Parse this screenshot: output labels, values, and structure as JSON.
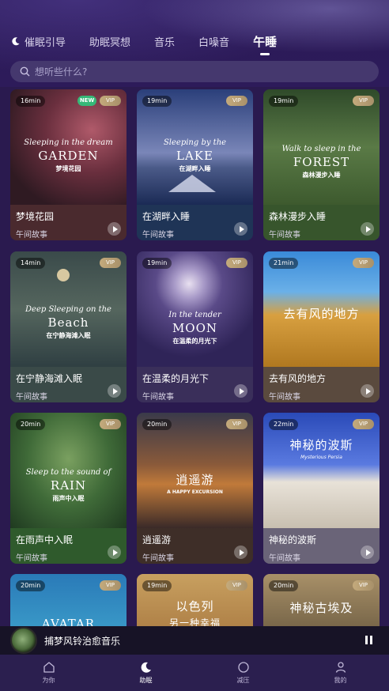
{
  "tabs": [
    {
      "label": "催眠引导"
    },
    {
      "label": "助眠冥想"
    },
    {
      "label": "音乐"
    },
    {
      "label": "白噪音"
    },
    {
      "label": "午睡"
    }
  ],
  "search": {
    "placeholder": "想听些什么?"
  },
  "cards": [
    {
      "title": "梦境花园",
      "sub": "午间故事",
      "duration": "16min",
      "vip": "VIP",
      "new": "NEW",
      "art": {
        "l1": "Sleeping in the dream",
        "l2": "GARDEN",
        "l3": "梦境花园"
      }
    },
    {
      "title": "在湖畔入睡",
      "sub": "午间故事",
      "duration": "19min",
      "vip": "VIP",
      "art": {
        "l1": "Sleeping by the",
        "l2": "LAKE",
        "l3": "在湖畔入睡"
      }
    },
    {
      "title": "森林漫步入睡",
      "sub": "午间故事",
      "duration": "19min",
      "vip": "VIP",
      "art": {
        "l1": "Walk to sleep in the",
        "l2": "FOREST",
        "l3": "森林漫步入睡"
      }
    },
    {
      "title": "在宁静海滩入眠",
      "sub": "午间故事",
      "duration": "14min",
      "vip": "VIP",
      "art": {
        "l1": "Deep Sleeping on the",
        "l2": "Beach",
        "l3": "在宁静海滩入眠"
      }
    },
    {
      "title": "在温柔的月光下",
      "sub": "午间故事",
      "duration": "19min",
      "vip": "VIP",
      "art": {
        "l1": "In the tender",
        "l2": "MOON",
        "l3": "在温柔的月光下"
      }
    },
    {
      "title": "去有风的地方",
      "sub": "午间故事",
      "duration": "21min",
      "vip": "VIP",
      "art": {
        "l1": "去有风的地方",
        "l2": "",
        "l3": ""
      }
    },
    {
      "title": "在雨声中入眠",
      "sub": "午间故事",
      "duration": "20min",
      "vip": "VIP",
      "art": {
        "l1": "Sleep to the sound of",
        "l2": "RAIN",
        "l3": "雨声中入眠"
      }
    },
    {
      "title": "逍遥游",
      "sub": "午间故事",
      "duration": "20min",
      "vip": "VIP",
      "art": {
        "l1": "逍遥游",
        "l2": "A HAPPY EXCURSION",
        "l3": ""
      }
    },
    {
      "title": "神秘的波斯",
      "sub": "午间故事",
      "duration": "22min",
      "vip": "VIP",
      "art": {
        "l1": "神秘的波斯",
        "l2": "Mysterious Persia",
        "l3": ""
      }
    },
    {
      "title": "",
      "sub": "",
      "duration": "20min",
      "vip": "VIP",
      "art": {
        "l1": "AVATAR",
        "l2": "",
        "l3": ""
      }
    },
    {
      "title": "",
      "sub": "",
      "duration": "19min",
      "vip": "VIP",
      "art": {
        "l1": "以色列",
        "l2": "另一种幸福",
        "l3": ""
      }
    },
    {
      "title": "",
      "sub": "",
      "duration": "20min",
      "vip": "VIP",
      "art": {
        "l1": "神秘古埃及",
        "l2": "",
        "l3": ""
      }
    }
  ],
  "player": {
    "title": "捕梦风铃治愈音乐"
  },
  "tabbar": [
    {
      "label": "为你"
    },
    {
      "label": "助眠"
    },
    {
      "label": "减压"
    },
    {
      "label": "我的"
    }
  ],
  "colors": {
    "background": "#2a1a4f",
    "vip_gold": "#c4aa7c",
    "new_green": "#37b878",
    "search_bg": "#45386e"
  }
}
